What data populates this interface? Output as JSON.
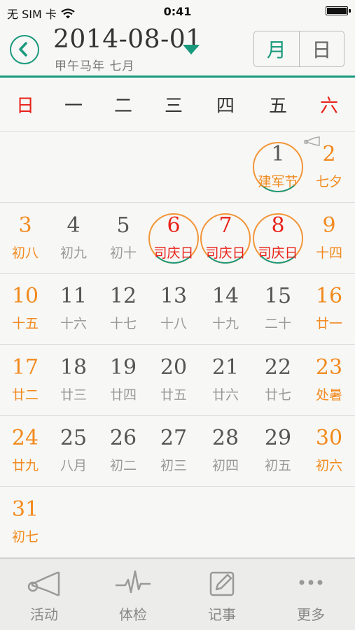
{
  "status": {
    "carrier": "无 SIM 卡",
    "time": "0:41"
  },
  "header": {
    "date": "2014-08-01",
    "lunar": "甲午马年  七月",
    "view_modes": [
      "月",
      "日"
    ],
    "active_view": "月",
    "accent": "#1a9a7d"
  },
  "weekdays": [
    "日",
    "一",
    "二",
    "三",
    "四",
    "五",
    "六"
  ],
  "weeks": [
    [
      null,
      null,
      null,
      null,
      null,
      {
        "day": "1",
        "lunar": "建军节",
        "type": "fest",
        "today": true
      },
      {
        "day": "2",
        "lunar": "七夕",
        "type": "we"
      }
    ],
    [
      {
        "day": "3",
        "lunar": "初八",
        "type": "we"
      },
      {
        "day": "4",
        "lunar": "初九"
      },
      {
        "day": "5",
        "lunar": "初十"
      },
      {
        "day": "6",
        "lunar": "司庆日",
        "type": "hol",
        "circled": true
      },
      {
        "day": "7",
        "lunar": "司庆日",
        "type": "hol",
        "circled": true
      },
      {
        "day": "8",
        "lunar": "司庆日",
        "type": "hol",
        "circled": true
      },
      {
        "day": "9",
        "lunar": "十四",
        "type": "we"
      }
    ],
    [
      {
        "day": "10",
        "lunar": "十五",
        "type": "we"
      },
      {
        "day": "11",
        "lunar": "十六"
      },
      {
        "day": "12",
        "lunar": "十七"
      },
      {
        "day": "13",
        "lunar": "十八"
      },
      {
        "day": "14",
        "lunar": "十九"
      },
      {
        "day": "15",
        "lunar": "二十"
      },
      {
        "day": "16",
        "lunar": "廿一",
        "type": "we"
      }
    ],
    [
      {
        "day": "17",
        "lunar": "廿二",
        "type": "we"
      },
      {
        "day": "18",
        "lunar": "廿三"
      },
      {
        "day": "19",
        "lunar": "廿四"
      },
      {
        "day": "20",
        "lunar": "廿五"
      },
      {
        "day": "21",
        "lunar": "廿六"
      },
      {
        "day": "22",
        "lunar": "廿七"
      },
      {
        "day": "23",
        "lunar": "处暑",
        "type": "we"
      }
    ],
    [
      {
        "day": "24",
        "lunar": "廿九",
        "type": "we"
      },
      {
        "day": "25",
        "lunar": "八月"
      },
      {
        "day": "26",
        "lunar": "初二"
      },
      {
        "day": "27",
        "lunar": "初三"
      },
      {
        "day": "28",
        "lunar": "初四"
      },
      {
        "day": "29",
        "lunar": "初五"
      },
      {
        "day": "30",
        "lunar": "初六",
        "type": "we"
      }
    ],
    [
      {
        "day": "31",
        "lunar": "初七",
        "type": "we"
      },
      null,
      null,
      null,
      null,
      null,
      null
    ]
  ],
  "tabs": [
    {
      "label": "活动",
      "icon": "horn-icon"
    },
    {
      "label": "体检",
      "icon": "heartbeat-icon"
    },
    {
      "label": "记事",
      "icon": "note-edit-icon"
    },
    {
      "label": "更多",
      "icon": "more-icon"
    }
  ],
  "colors": {
    "weekend": "#f28a1e",
    "holiday": "#e8221a",
    "ring": "#f2963a"
  }
}
